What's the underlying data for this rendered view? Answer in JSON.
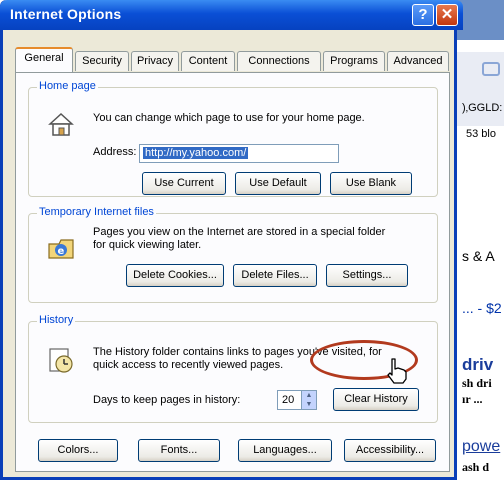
{
  "window": {
    "title": "Internet Options",
    "help_symbol": "?",
    "close_symbol": "✕"
  },
  "tabs": [
    "General",
    "Security",
    "Privacy",
    "Content",
    "Connections",
    "Programs",
    "Advanced"
  ],
  "home_page": {
    "group_label": "Home page",
    "description": "You can change which page to use for your home page.",
    "address_label": "Address:",
    "address_value": "http://my.yahoo.com/",
    "buttons": [
      "Use Current",
      "Use Default",
      "Use Blank"
    ]
  },
  "temp_files": {
    "group_label": "Temporary Internet files",
    "description_line1": "Pages you view on the Internet are stored in a special folder",
    "description_line2": "for quick viewing later.",
    "buttons": [
      "Delete Cookies...",
      "Delete Files...",
      "Settings..."
    ]
  },
  "history": {
    "group_label": "History",
    "description_line1": "The History folder contains links to pages you've visited, for",
    "description_line2": "quick access to recently viewed pages.",
    "days_label": "Days to keep pages in history:",
    "days_value": "20",
    "clear_button": "Clear History"
  },
  "bottom_buttons": [
    "Colors...",
    "Fonts...",
    "Languages...",
    "Accessibility..."
  ],
  "background_page": {
    "snippets": [
      ")‚GGLD:",
      "53 blo",
      "s & A",
      "... - $2",
      "driv",
      "sh dri",
      "ır ...",
      "powe",
      "ash d"
    ]
  },
  "colors": {
    "titlebar": "#0a4fd6",
    "group_label": "#0046d5",
    "active_tab_accent": "#e68b2c",
    "annotation_circle": "#b23a1e"
  }
}
